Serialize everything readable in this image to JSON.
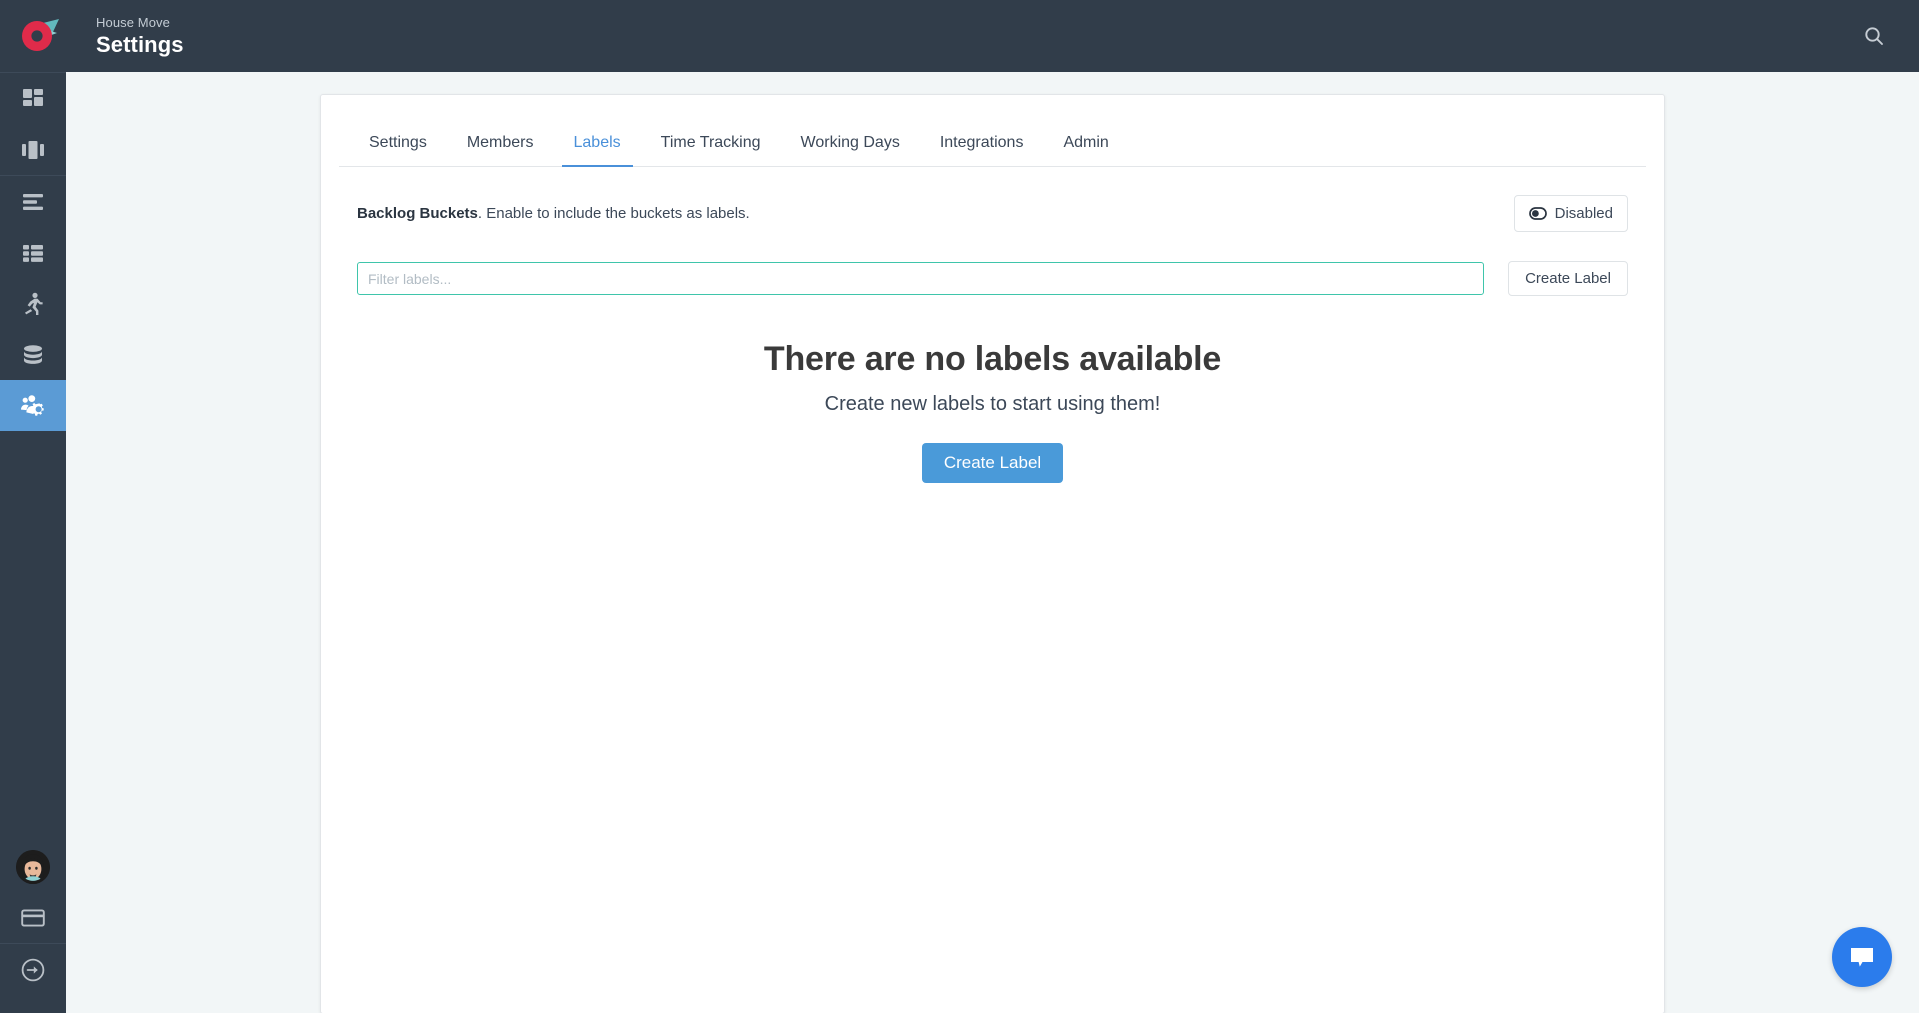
{
  "header": {
    "project_name": "House Move",
    "page_title": "Settings",
    "search_icon": "search-icon"
  },
  "sidebar": {
    "groups": [
      {
        "items": [
          {
            "icon": "dashboard-grid-icon",
            "name": "sidebar-item-dashboard",
            "active": false
          },
          {
            "icon": "kanban-board-icon",
            "name": "sidebar-item-board",
            "active": false
          }
        ]
      },
      {
        "items": [
          {
            "icon": "backlog-list-icon",
            "name": "sidebar-item-backlog",
            "active": false
          },
          {
            "icon": "table-grid-icon",
            "name": "sidebar-item-table",
            "active": false
          },
          {
            "icon": "running-person-icon",
            "name": "sidebar-item-sprints",
            "active": false
          },
          {
            "icon": "database-icon",
            "name": "sidebar-item-data",
            "active": false
          },
          {
            "icon": "users-gear-icon",
            "name": "sidebar-item-settings",
            "active": true
          }
        ]
      }
    ],
    "bottom": [
      {
        "icon": "user-avatar",
        "name": "avatar"
      },
      {
        "icon": "credit-card-icon",
        "name": "sidebar-item-billing"
      },
      {
        "icon": "logout-arrow-icon",
        "name": "sidebar-item-logout"
      }
    ]
  },
  "tabs": [
    {
      "label": "Settings",
      "active": false
    },
    {
      "label": "Members",
      "active": false
    },
    {
      "label": "Labels",
      "active": true
    },
    {
      "label": "Time Tracking",
      "active": false
    },
    {
      "label": "Working Days",
      "active": false
    },
    {
      "label": "Integrations",
      "active": false
    },
    {
      "label": "Admin",
      "active": false
    }
  ],
  "backlog": {
    "label_bold": "Backlog Buckets",
    "label_rest": ". Enable to include the buckets as labels.",
    "toggle_label": "Disabled",
    "toggle_icon": "toggle-off-icon"
  },
  "filter": {
    "placeholder": "Filter labels...",
    "value": "",
    "create_button": "Create Label"
  },
  "empty_state": {
    "title": "There are no labels available",
    "subtitle": "Create new labels to start using them!",
    "button": "Create Label"
  },
  "chat": {
    "icon": "chat-bubble-icon"
  },
  "colors": {
    "topbar": "#313d4a",
    "sidebar": "#313d4a",
    "page_bg": "#f2f6f7",
    "accent_blue": "#4a9ad9",
    "active_tab_blue": "#4a90d9",
    "input_focus_teal": "#3fc5ab",
    "chat_blue": "#2b7cec",
    "logo_red": "#e02b4a",
    "logo_teal": "#62b9bd"
  }
}
